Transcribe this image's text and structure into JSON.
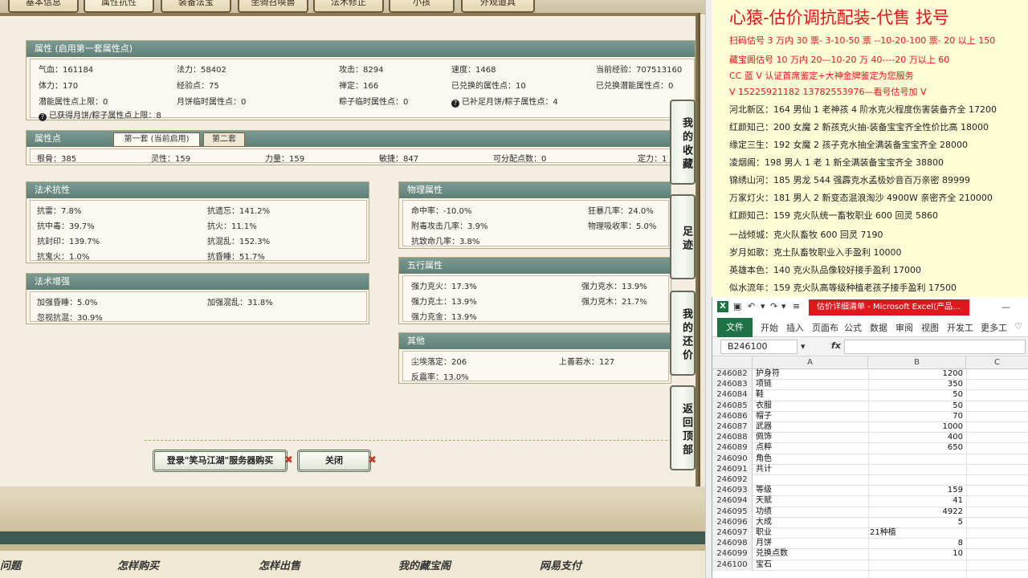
{
  "tabs": [
    "基本信息",
    "属性抗性",
    "装备法宝",
    "坐骑召唤兽",
    "法术修正",
    "小孩",
    "外观道具"
  ],
  "attr_main": {
    "title": "属性 (启用第一套属性点)",
    "rows": [
      [
        "气血：161184",
        "法力：58402",
        "攻击：8294",
        "速度：1468",
        "当前经验：707513160"
      ],
      [
        "体力：170",
        "经验点：75",
        "禅定：166",
        "已兑换的属性点：10",
        "已兑换潜能属性点：0"
      ],
      [
        "潜能属性点上限：0",
        "月饼临时属性点：0",
        "粽子临时属性点：0",
        "已补足月饼/粽子属性点：4",
        ""
      ]
    ],
    "note": "已获得月饼/粽子属性点上限：8"
  },
  "attr_points": {
    "title": "属性点",
    "tab1": "第一套 (当前启用)",
    "tab2": "第二套",
    "values": [
      "根骨：385",
      "灵性：159",
      "力量：159",
      "敏捷：847",
      "可分配点数：0",
      "定力：1"
    ]
  },
  "spell_resist": {
    "title": "法术抗性",
    "rows": [
      [
        "抗雷：7.8%",
        "抗遗忘：141.2%"
      ],
      [
        "抗中毒：39.7%",
        "抗火：11.1%"
      ],
      [
        "抗封印：139.7%",
        "抗混乱：152.3%"
      ],
      [
        "抗鬼火：1.0%",
        "抗昏睡：51.7%"
      ]
    ]
  },
  "spell_boost": {
    "title": "法术增强",
    "rows": [
      [
        "加强昏睡：5.0%",
        "加强混乱：31.8%"
      ],
      [
        "忽视抗混：30.9%",
        ""
      ]
    ]
  },
  "physical": {
    "title": "物理属性",
    "rows": [
      [
        "命中率：-10.0%",
        "狂暴几率：24.0%"
      ],
      [
        "附毒攻击几率：3.9%",
        "物理吸收率：5.0%"
      ],
      [
        "抗致命几率：3.8%",
        ""
      ]
    ]
  },
  "elements": {
    "title": "五行属性",
    "rows": [
      [
        "强力克火：17.3%",
        "强力克水：13.9%"
      ],
      [
        "强力克土：13.9%",
        "强力克木：21.7%"
      ],
      [
        "强力克金：13.9%",
        ""
      ]
    ]
  },
  "other": {
    "title": "其他",
    "rows": [
      [
        "尘埃落定：206",
        "上善若水：127"
      ],
      [
        "反震率：13.0%",
        ""
      ]
    ]
  },
  "side_buttons": [
    "我的收藏",
    "足迹",
    "我的还价",
    "返回顶部"
  ],
  "buttons": {
    "login_buy": "登录\"笑马江湖\"服务器购买",
    "close": "关闭"
  },
  "footer_nav": [
    "问题",
    "怎样购买",
    "怎样出售",
    "我的藏宝阁",
    "网易支付"
  ],
  "ad": {
    "title": "心猿-估价调抗配装-代售 找号",
    "lines": [
      {
        "text": "扫码估号 3 万内 30 票- 3-10-50 票 --10-20-100 票- 20 以上 150",
        "red": true
      },
      {
        "text": "藏宝阁估号 10 万内 20—10-20 万 40----20 万以上 60",
        "red": true
      },
      {
        "text": "CC 蓝 V 认证首席鉴定+大神金牌鉴定为您服务",
        "red": true
      },
      {
        "text": "V 15225921182     13782553976—看号估号加 V",
        "red": true
      },
      {
        "text": "河北新区：164 男仙 1 老神孩 4 阶水克火程度伤害装备齐全 17200",
        "red": false
      },
      {
        "text": "红颜知己：200 女魔 2 新孩克火抽-装备宝宝齐全性价比高 18000",
        "red": false
      },
      {
        "text": "缘定三生：192 女魔 2 孩子克水抽全满装备宝宝齐全 28000",
        "red": false
      },
      {
        "text": "凌烟阁：198 男人 1 老 1 新全满装备宝宝齐全 38800",
        "red": false
      },
      {
        "text": "锦绣山河：185 男龙 544 强霹克水孟极妙音百万亲密 89999",
        "red": false
      },
      {
        "text": "万家灯火：181 男人 2 新变态混浪淘沙 4900W 亲密齐全 210000",
        "red": false
      },
      {
        "text": "红颜知己：159 克火队统一畜牧职业 600 回灵 5860",
        "red": false
      },
      {
        "text": "一战倾城：克火队畜牧 600 回灵 7190",
        "red": false
      },
      {
        "text": "岁月如歌：克土队畜牧职业入手盈利 10000",
        "red": false
      },
      {
        "text": "英雄本色：140 克火队品像较好接手盈利 17000",
        "red": false
      },
      {
        "text": "似水流年：159 克火队高等级种植老孩子接手盈利 17500",
        "red": false
      }
    ]
  },
  "excel": {
    "logo": "X",
    "title": "估价详细清单 - Microsoft Excel(产品...",
    "ribbon_file": "文件",
    "ribbon_tabs": [
      "开始",
      "插入",
      "页面布",
      "公式",
      "数据",
      "审阅",
      "视图",
      "开发工",
      "更多工"
    ],
    "name_box": "B246100",
    "fx": "fx",
    "columns": [
      "A",
      "B",
      "C"
    ],
    "rows": [
      {
        "n": "246082",
        "a": "护身符",
        "b": "1200"
      },
      {
        "n": "246083",
        "a": "项链",
        "b": "350"
      },
      {
        "n": "246084",
        "a": "鞋",
        "b": "50"
      },
      {
        "n": "246085",
        "a": "衣服",
        "b": "50"
      },
      {
        "n": "246086",
        "a": "帽子",
        "b": "70"
      },
      {
        "n": "246087",
        "a": "武器",
        "b": "1000"
      },
      {
        "n": "246088",
        "a": "佩饰",
        "b": "400"
      },
      {
        "n": "246089",
        "a": "点粹",
        "b": "650"
      },
      {
        "n": "246090",
        "a": "角色",
        "b": ""
      },
      {
        "n": "246091",
        "a": "共计",
        "b": ""
      },
      {
        "n": "246092",
        "a": "",
        "b": ""
      },
      {
        "n": "246093",
        "a": "等级",
        "b": "159"
      },
      {
        "n": "246094",
        "a": "天赋",
        "b": "41"
      },
      {
        "n": "246095",
        "a": "功绩",
        "b": "4922"
      },
      {
        "n": "246096",
        "a": "大成",
        "b": "5"
      },
      {
        "n": "246097",
        "a": "职业",
        "b": "21种植",
        "left": true
      },
      {
        "n": "246098",
        "a": "月饼",
        "b": "8"
      },
      {
        "n": "246099",
        "a": "兑换点数",
        "b": "10"
      },
      {
        "n": "246100",
        "a": "宝石",
        "b": ""
      }
    ]
  }
}
